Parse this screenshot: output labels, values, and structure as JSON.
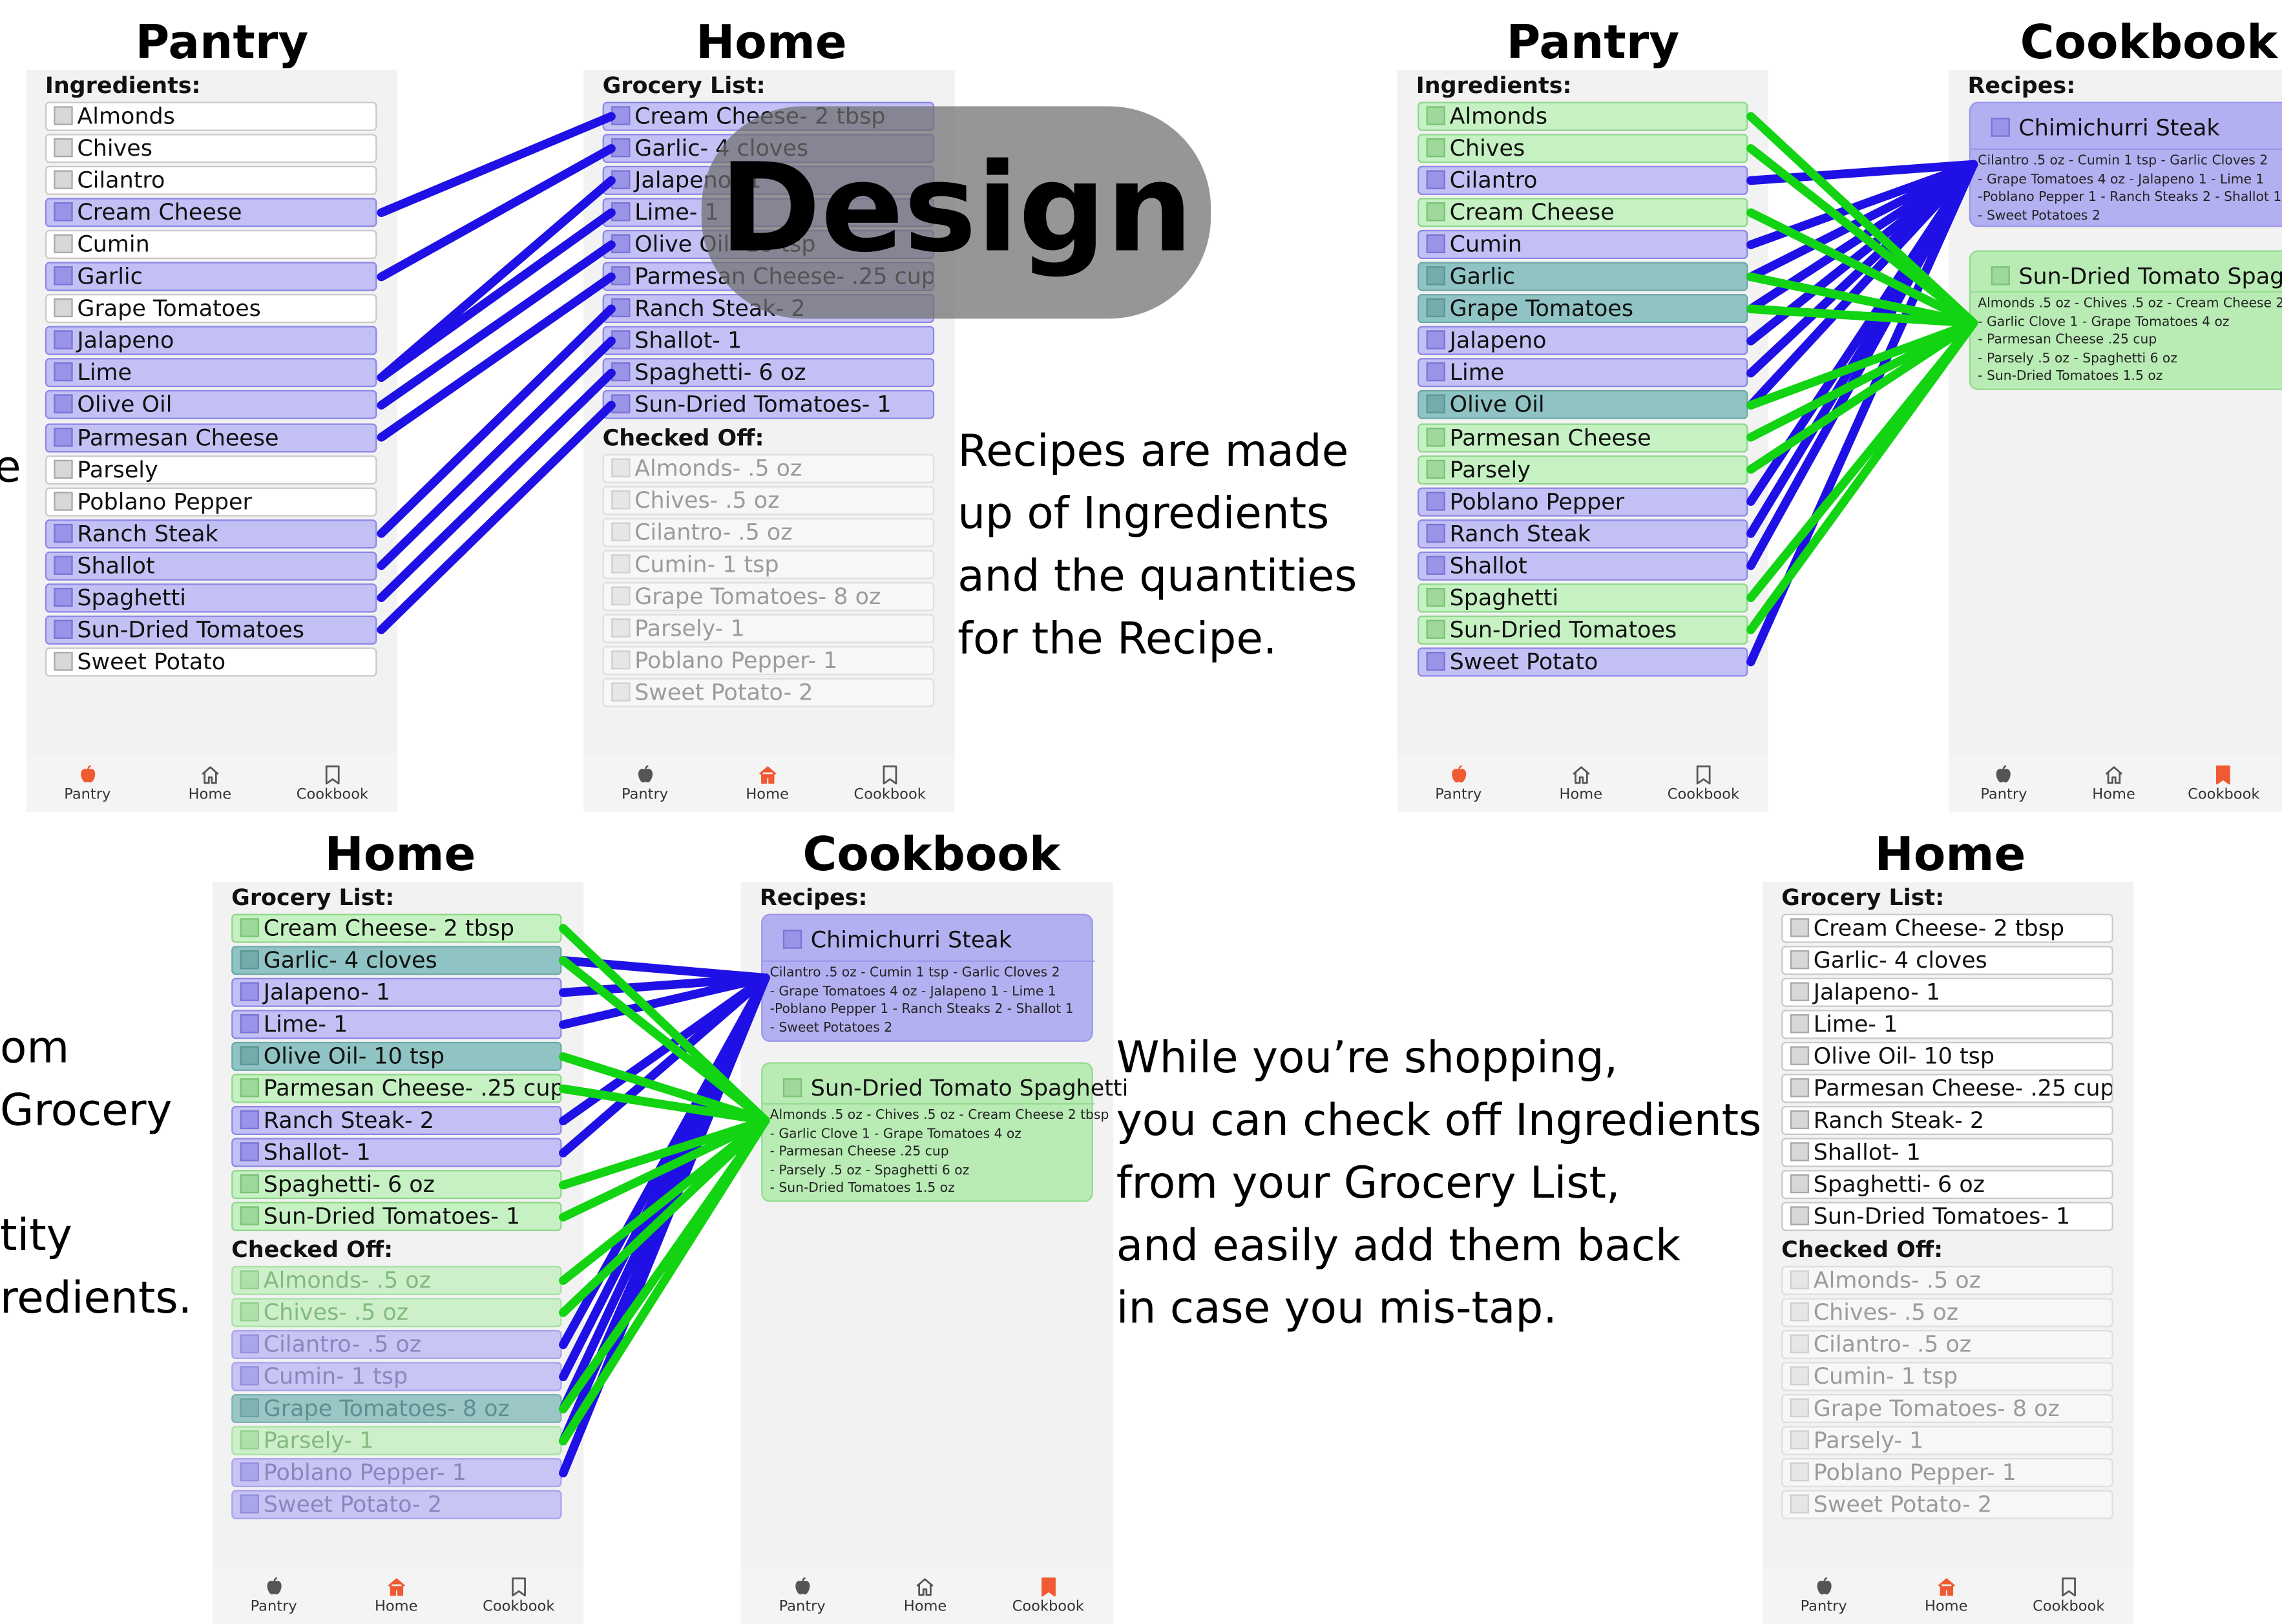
{
  "colors": {
    "blue_connector": "#1f10e6",
    "green_connector": "#12d412",
    "tab_active": "#ef5a33"
  },
  "overlay_badge": "Design",
  "tabs": {
    "pantry": "Pantry",
    "home": "Home",
    "cookbook": "Cookbook"
  },
  "icons": {
    "pantry": "apple-icon",
    "home": "house-icon",
    "cookbook": "bookmark-book-icon"
  },
  "pantry": {
    "ingredients_header": "Ingredients:",
    "items": [
      "Almonds",
      "Chives",
      "Cilantro",
      "Cream Cheese",
      "Cumin",
      "Garlic",
      "Grape Tomatoes",
      "Jalapeno",
      "Lime",
      "Olive Oil",
      "Parmesan Cheese",
      "Parsely",
      "Poblano Pepper",
      "Ranch Steak",
      "Shallot",
      "Spaghetti",
      "Sun-Dried Tomatoes",
      "Sweet Potato"
    ]
  },
  "home": {
    "grocery_header": "Grocery List:",
    "checked_header": "Checked Off:",
    "grocery_items": [
      "Cream Cheese- 2 tbsp",
      "Garlic- 4 cloves",
      "Jalapeno- 1",
      "Lime- 1",
      "Olive Oil- 10 tsp",
      "Parmesan Cheese- .25 cup",
      "Ranch Steak- 2",
      "Shallot- 1",
      "Spaghetti- 6 oz",
      "Sun-Dried Tomatoes- 1"
    ],
    "checked_items": [
      "Almonds- .5 oz",
      "Chives- .5 oz",
      "Cilantro- .5 oz",
      "Cumin- 1 tsp",
      "Grape Tomatoes- 8 oz",
      "Parsely- 1",
      "Poblano Pepper- 1",
      "Sweet Potato- 2"
    ]
  },
  "cookbook": {
    "recipes_header": "Recipes:",
    "recipes": [
      {
        "title": "Chimichurri Steak",
        "lines": [
          "Cilantro .5 oz - Cumin 1 tsp - Garlic Cloves 2",
          "- Grape Tomatoes 4 oz - Jalapeno 1 - Lime 1",
          "-Poblano Pepper 1 - Ranch Steaks 2 - Shallot 1",
          "- Sweet Potatoes 2"
        ]
      },
      {
        "title": "Sun-Dried Tomato Spaghetti",
        "lines": [
          "Almonds .5 oz - Chives .5 oz - Cream Cheese 2 tbsp",
          "- Garlic Clove 1 - Grape Tomatoes 4 oz",
          "- Parmesan Cheese .25 cup",
          "- Parsely .5 oz - Spaghetti 6 oz",
          "- Sun-Dried Tomatoes 1.5 oz"
        ]
      }
    ]
  },
  "screens": {
    "s1_title": "Pantry",
    "s2_title": "Home",
    "s3_title": "Pantry",
    "s4_title": "Cookbook",
    "s5_title": "Home",
    "s6_title": "Cookbook",
    "s7_title": "Home"
  },
  "annotations": {
    "recipes": [
      "Recipes are made",
      "up of Ingredients",
      "and the quantities",
      "for the Recipe."
    ],
    "shopping": [
      "While you’re shopping,",
      "you can check off Ingredients",
      "from your Grocery List,",
      "and easily add them back",
      "in case you mis-tap."
    ],
    "left_fragments_top": [
      "e"
    ],
    "left_fragments_bottom": [
      "om",
      "Grocery",
      "",
      "tity",
      "redients."
    ]
  }
}
